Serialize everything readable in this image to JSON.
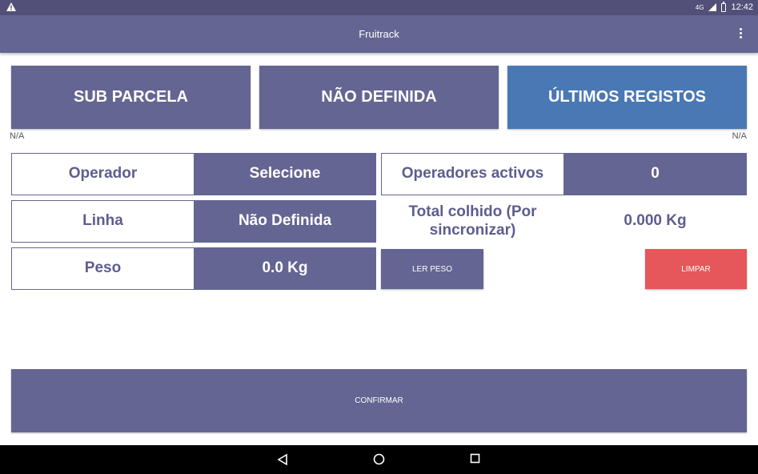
{
  "status_bar": {
    "warning_icon": "warning-icon",
    "network": "4G",
    "time": "12:42"
  },
  "app_bar": {
    "title": "Fruitrack",
    "menu_icon": "overflow-menu-icon"
  },
  "top_buttons": {
    "sub_parcela": "SUB PARCELA",
    "nao_definida": "NÃO DEFINIDA",
    "ultimos_registos": "ÚLTIMOS REGISTOS"
  },
  "na_left": "N/A",
  "na_right": "N/A",
  "form": {
    "operador_label": "Operador",
    "operador_value": "Selecione",
    "linha_label": "Linha",
    "linha_value": "Não Definida",
    "peso_label": "Peso",
    "peso_value": "0.0 Kg",
    "operadores_label": "Operadores activos",
    "operadores_value": "0",
    "total_label": "Total colhido (Por sincronizar)",
    "total_value": "0.000 Kg"
  },
  "actions": {
    "ler_peso": "LER PESO",
    "limpar": "LIMPAR",
    "confirmar": "CONFIRMAR"
  },
  "colors": {
    "primary": "#646592",
    "accent_blue": "#4a78b4",
    "danger": "#e5575a",
    "status_bar": "#525078"
  }
}
